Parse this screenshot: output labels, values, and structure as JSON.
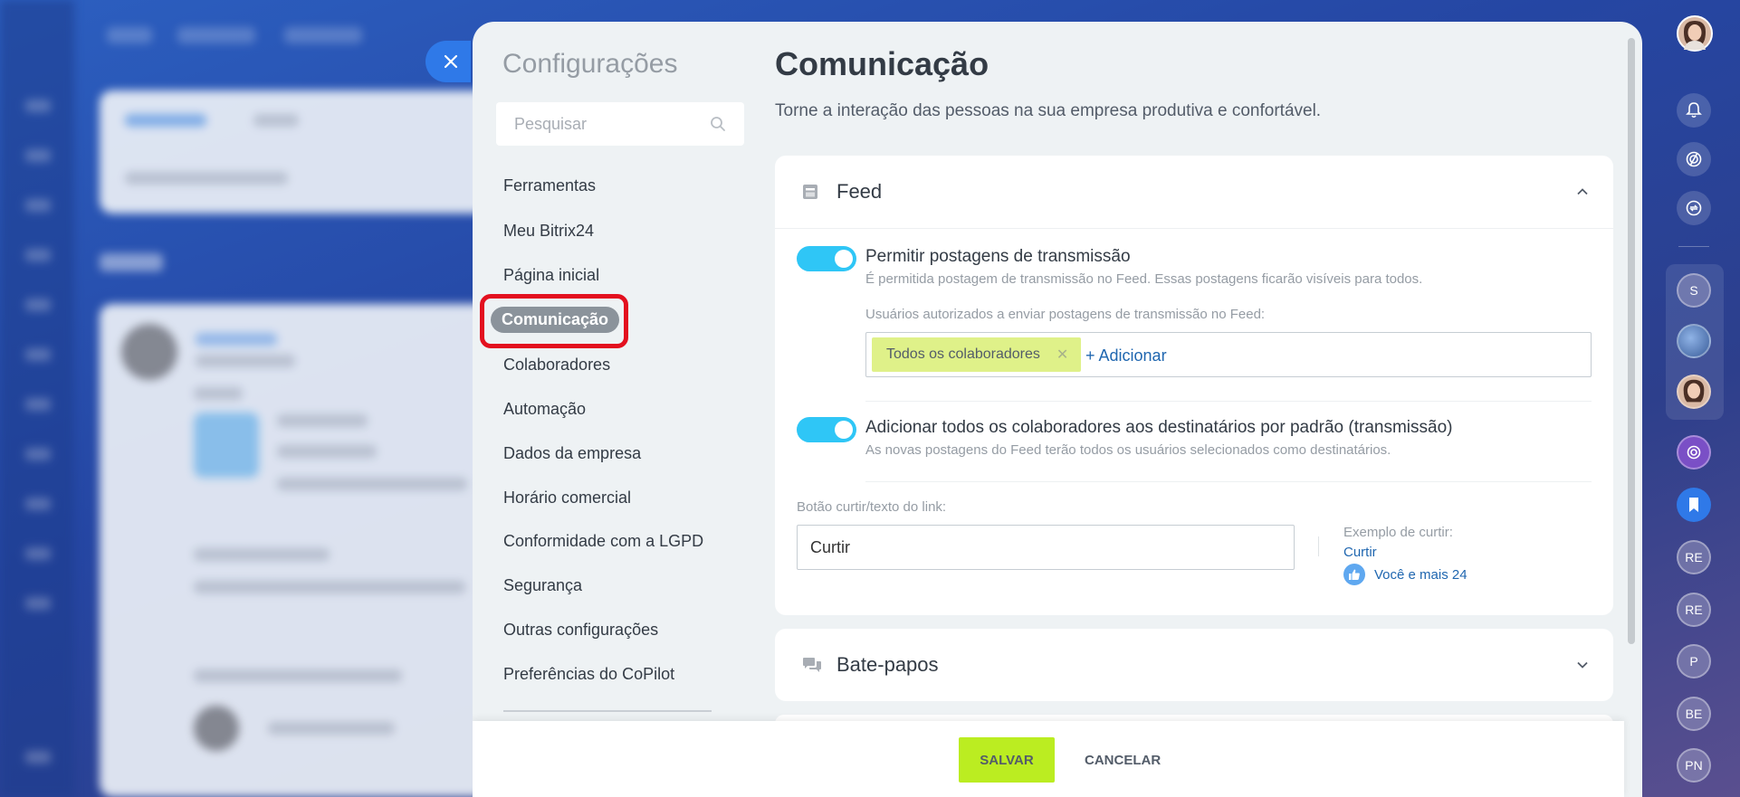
{
  "settings": {
    "title": "Configurações",
    "search_placeholder": "Pesquisar",
    "menu": [
      {
        "label": "Ferramentas"
      },
      {
        "label": "Meu Bitrix24"
      },
      {
        "label": "Página inicial"
      },
      {
        "label": "Comunicação",
        "active": true
      },
      {
        "label": "Colaboradores"
      },
      {
        "label": "Automação"
      },
      {
        "label": "Dados da empresa"
      },
      {
        "label": "Horário comercial"
      },
      {
        "label": "Conformidade com a LGPD"
      },
      {
        "label": "Segurança"
      },
      {
        "label": "Outras configurações"
      },
      {
        "label": "Preferências do CoPilot"
      }
    ]
  },
  "page": {
    "title": "Comunicação",
    "subtitle": "Torne a interação das pessoas na sua empresa produtiva e confortável."
  },
  "feed": {
    "title": "Feed",
    "icon": "feed-icon",
    "expanded": true,
    "broadcast": {
      "enabled": true,
      "label": "Permitir postagens de transmissão",
      "description": "É permitida postagem de transmissão no Feed. Essas postagens ficarão visíveis para todos.",
      "users_label": "Usuários autorizados a enviar postagens de transmissão no Feed:",
      "tag": "Todos os colaboradores",
      "add_label": "+ Adicionar"
    },
    "default_recipients": {
      "enabled": true,
      "label": "Adicionar todos os colaboradores aos destinatários por padrão (transmissão)",
      "description": "As novas postagens do Feed terão todos os usuários selecionados como destinatários."
    },
    "like": {
      "field_label": "Botão curtir/texto do link:",
      "value": "Curtir",
      "example_label": "Exemplo de curtir:",
      "example_link": "Curtir",
      "example_count": "Você e mais 24"
    }
  },
  "chats": {
    "title": "Bate-papos",
    "icon": "chat-icon",
    "expanded": false
  },
  "footer": {
    "save_label": "SALVAR",
    "cancel_label": "CANCELAR"
  },
  "right_rail": {
    "avatars": [
      "S",
      "RE",
      "RE",
      "P",
      "BE",
      "PN"
    ]
  },
  "colors": {
    "accent": "#2fc6f6",
    "save": "#bbed21",
    "highlight": "#e3101f",
    "tag": "#dff189",
    "link": "#2067b0"
  }
}
